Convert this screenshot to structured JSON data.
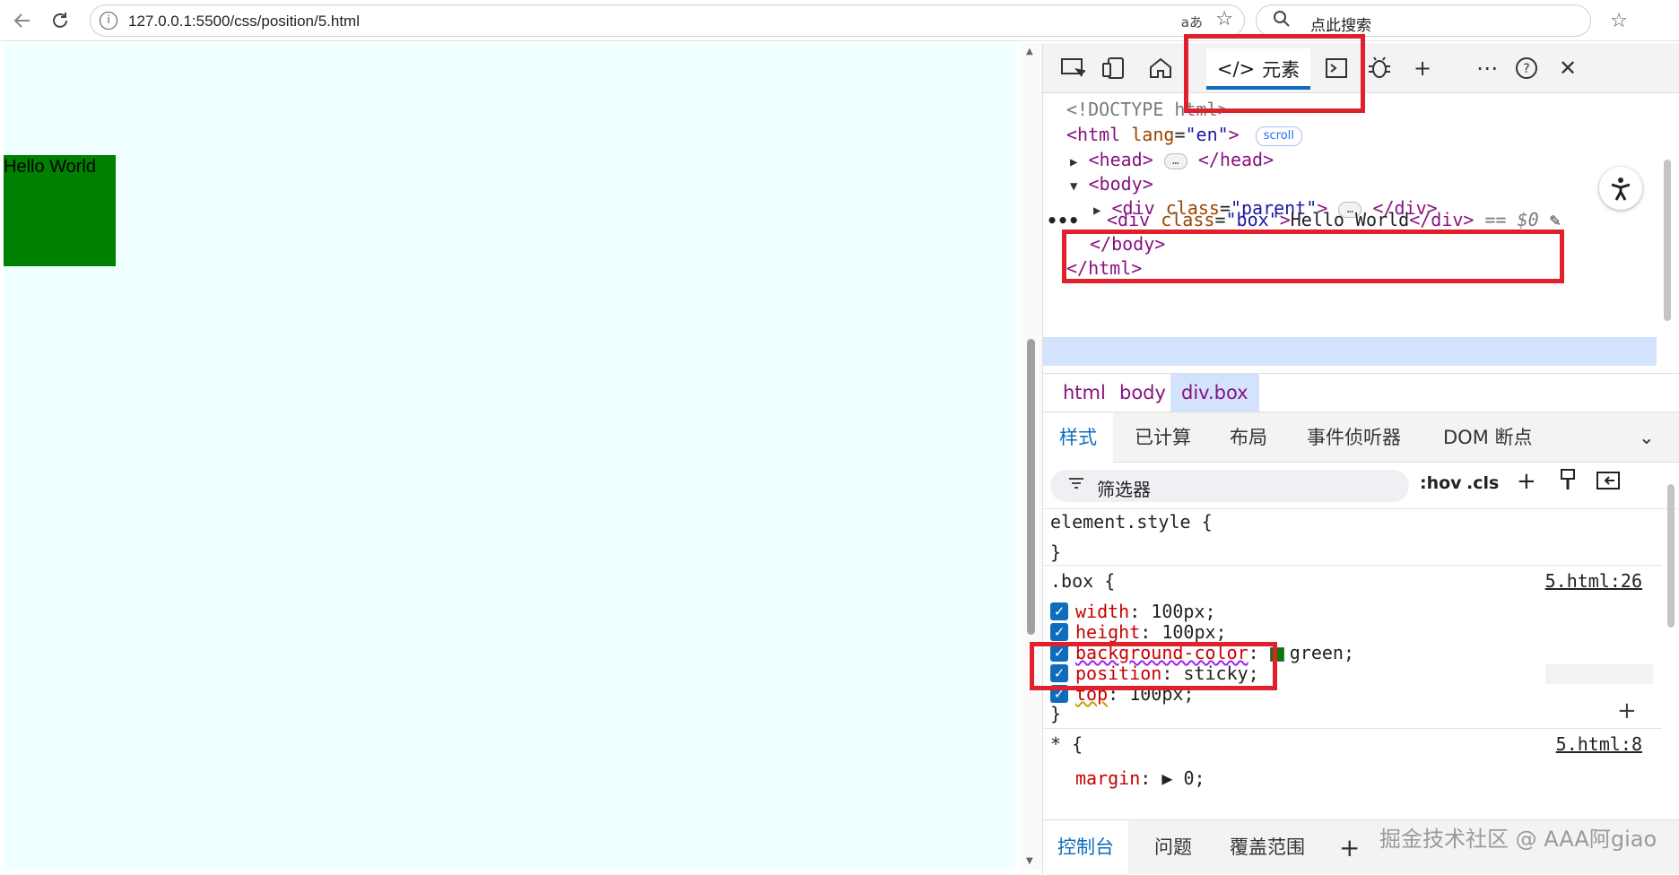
{
  "browser": {
    "url": "127.0.0.1:5500/css/position/5.html",
    "translate_label": "aあ",
    "search_placeholder": "点此搜索",
    "icons": [
      "back-icon",
      "reload-icon",
      "info-icon",
      "translate-icon",
      "favorite-icon",
      "search-icon",
      "favorites-bar-icon"
    ]
  },
  "page": {
    "box_text": "Hello World",
    "box_color": "#008000",
    "background": "#f0ffff"
  },
  "devtools": {
    "elements_tab_label": "元素",
    "dom": {
      "doctype": "<!DOCTYPE html>",
      "html_open_tag": "<html",
      "html_lang_attr": "lang",
      "html_lang_val": "\"en\"",
      "html_close_bracket": ">",
      "scroll_badge": "scroll",
      "head_open": "<head>",
      "head_close": "</head>",
      "ellipsis": "…",
      "body_open": "<body>",
      "parent_div_open": "<div",
      "parent_class_attr": "class",
      "parent_class_val": "\"parent\"",
      "parent_div_close": "</div>",
      "box_div_open": "<div",
      "box_class_attr": "class",
      "box_class_val": "\"box\"",
      "box_text": "Hello World",
      "box_div_close": "</div>",
      "dollar_ref": "== $0",
      "body_close": "</body>",
      "html_close": "</html>"
    },
    "breadcrumbs": [
      "html",
      "body",
      "div.box"
    ],
    "panel_tabs": [
      "样式",
      "已计算",
      "布局",
      "事件侦听器",
      "DOM 断点"
    ],
    "filter_placeholder": "筛选器",
    "filter_tools": {
      "hov": ":hov",
      "cls": ".cls"
    },
    "styles": {
      "element_style": "element.style {",
      "close_brace": "}",
      "box_selector": ".box {",
      "box_source": "5.html:26",
      "box_props": [
        {
          "name": "width",
          "value": "100px;"
        },
        {
          "name": "height",
          "value": "100px;"
        },
        {
          "name": "background-color",
          "value": "green;"
        },
        {
          "name": "position",
          "value": "sticky;"
        },
        {
          "name": "top",
          "value": "100px;"
        }
      ],
      "star_selector": "* {",
      "star_source": "5.html:8",
      "star_props": [
        {
          "name": "margin",
          "value": "0;"
        }
      ]
    },
    "drawer_tabs": [
      "控制台",
      "问题",
      "覆盖范围"
    ],
    "watermark": "掘金技术社区 @ AAA阿giao"
  },
  "colors": {
    "highlight": "#e0202a",
    "accent": "#0f6cbd",
    "tag": "#881280",
    "property": "#c80000"
  }
}
